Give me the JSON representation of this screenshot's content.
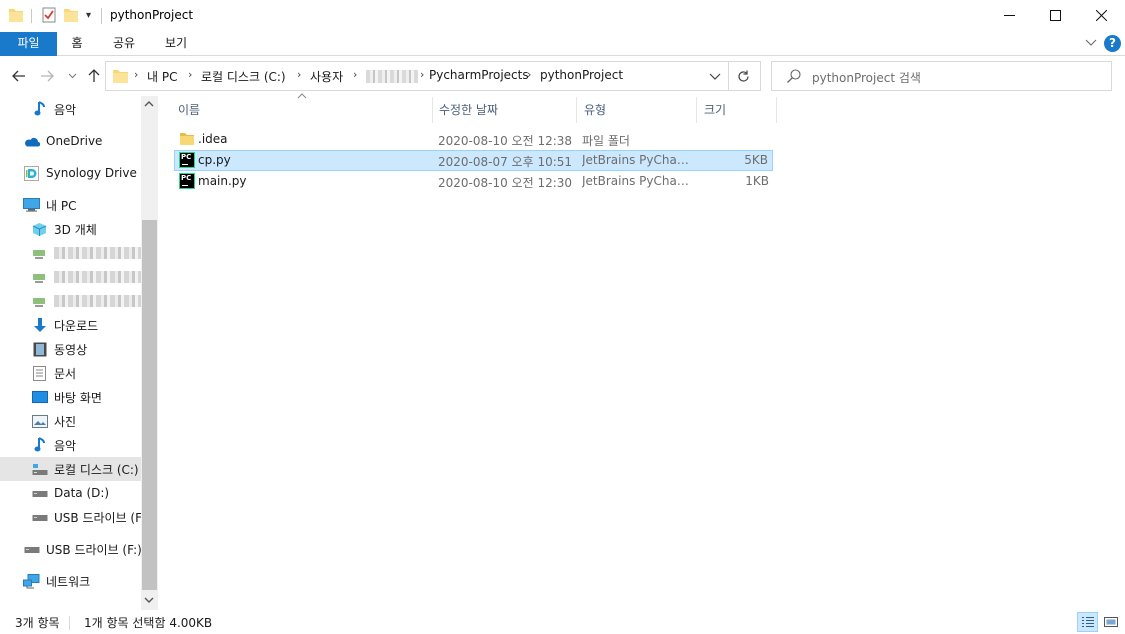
{
  "window": {
    "title": "pythonProject",
    "colors": {
      "accent": "#1979ca",
      "selection_bg": "#cce8ff",
      "selection_border": "#99d1ff",
      "folder": "#f8d775"
    }
  },
  "ribbon": {
    "tabs": [
      {
        "label": "파일",
        "active": true
      },
      {
        "label": "홈"
      },
      {
        "label": "공유"
      },
      {
        "label": "보기"
      }
    ],
    "help_label": "?"
  },
  "address": {
    "breadcrumbs": [
      "내 PC",
      "로컬 디스크 (C:)",
      "사용자",
      "PycharmProjects",
      "pythonProject"
    ]
  },
  "search": {
    "placeholder": "pythonProject 검색"
  },
  "sidebar": {
    "items": [
      {
        "label": "음악",
        "icon": "music-icon"
      },
      {
        "label": "OneDrive",
        "icon": "onedrive-cloud-icon"
      },
      {
        "label": "Synology Drive -",
        "icon": "synology-drive-icon"
      },
      {
        "label": "내 PC",
        "icon": "computer-icon"
      },
      {
        "label": "3D 개체",
        "icon": "3d-objects-icon"
      },
      {
        "label": "",
        "icon": "network-drive-icon",
        "redacted": true
      },
      {
        "label": "",
        "icon": "network-drive-icon",
        "redacted": true
      },
      {
        "label": "",
        "icon": "network-drive-icon",
        "redacted": true
      },
      {
        "label": "다운로드",
        "icon": "download-icon"
      },
      {
        "label": "동영상",
        "icon": "video-icon"
      },
      {
        "label": "문서",
        "icon": "document-icon"
      },
      {
        "label": "바탕 화면",
        "icon": "desktop-icon"
      },
      {
        "label": "사진",
        "icon": "picture-icon"
      },
      {
        "label": "음악",
        "icon": "music-icon"
      },
      {
        "label": "로컬 디스크 (C:)",
        "icon": "local-disk-icon",
        "selected": true
      },
      {
        "label": "Data (D:)",
        "icon": "drive-icon"
      },
      {
        "label": "USB 드라이브 (F:)",
        "icon": "usb-drive-icon"
      },
      {
        "label": "USB 드라이브 (F:)",
        "icon": "usb-drive-icon"
      },
      {
        "label": "네트워크",
        "icon": "network-icon"
      }
    ]
  },
  "columns": [
    {
      "label": "이름"
    },
    {
      "label": "수정한 날짜"
    },
    {
      "label": "유형"
    },
    {
      "label": "크기"
    }
  ],
  "files": [
    {
      "name": ".idea",
      "date": "2020-08-10 오전 12:38",
      "type": "파일 폴더",
      "size": "",
      "icon": "folder-icon",
      "selected": false
    },
    {
      "name": "cp.py",
      "date": "2020-08-07 오후 10:51",
      "type": "JetBrains PyCharm",
      "size": "5KB",
      "icon": "pycharm-file-icon",
      "selected": true
    },
    {
      "name": "main.py",
      "date": "2020-08-10 오전 12:30",
      "type": "JetBrains PyCharm",
      "size": "1KB",
      "icon": "pycharm-file-icon",
      "selected": false
    }
  ],
  "status": {
    "count": "3개 항목",
    "selection": "1개 항목 선택함 4.00KB"
  }
}
